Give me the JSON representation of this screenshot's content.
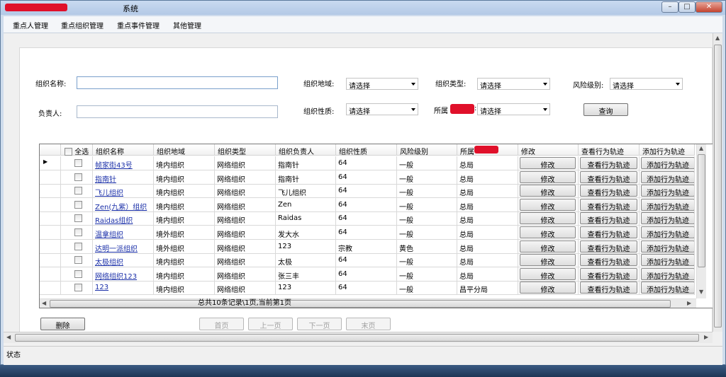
{
  "window": {
    "title": "系统",
    "title_prefix_redacted": "██████案系统",
    "controls": {
      "minimize": "–",
      "maximize": "□",
      "close": "✕"
    }
  },
  "menu": [
    "重点人管理",
    "重点组织管理",
    "重点事件管理",
    "其他管理"
  ],
  "filters": {
    "org_name_label": "组织名称:",
    "org_name_value": "",
    "owner_label": "负责人:",
    "owner_value": "",
    "region_label": "组织地域:",
    "region_value": "请选择",
    "type_label": "组织类型:",
    "type_value": "请选择",
    "risk_label": "风险级别:",
    "risk_value": "请选择",
    "nature_label": "组织性质:",
    "nature_value": "请选择",
    "belong_label": "所属",
    "belong_label_suffix": ":",
    "belong_value": "请选择",
    "query_button": "查询"
  },
  "grid": {
    "select_all": "全选",
    "columns": [
      "组织名称",
      "组织地域",
      "组织类型",
      "组织负责人",
      "组织性质",
      "风险级别",
      "所属",
      "修改",
      "查看行为轨迹",
      "添加行为轨迹"
    ],
    "row_buttons": {
      "edit": "修改",
      "view": "查看行为轨迹",
      "add": "添加行为轨迹"
    },
    "rows": [
      {
        "name": "帧家街43号",
        "region": "境内组织",
        "type": "网络组织",
        "owner": "指南针",
        "nature": "64",
        "risk": "一般",
        "belong": "总局"
      },
      {
        "name": "指南针",
        "region": "境内组织",
        "type": "网络组织",
        "owner": "指南针",
        "nature": "64",
        "risk": "一般",
        "belong": "总局"
      },
      {
        "name": "飞儿组织",
        "region": "境内组织",
        "type": "网络组织",
        "owner": "飞儿组织",
        "nature": "64",
        "risk": "一般",
        "belong": "总局"
      },
      {
        "name": "Zen(九紫）组织",
        "region": "境内组织",
        "type": "网络组织",
        "owner": "Zen",
        "nature": "64",
        "risk": "一般",
        "belong": "总局"
      },
      {
        "name": "Raidas组织",
        "region": "境内组织",
        "type": "网络组织",
        "owner": "Raidas",
        "nature": "64",
        "risk": "一般",
        "belong": "总局"
      },
      {
        "name": "温拿组织",
        "region": "境外组织",
        "type": "网络组织",
        "owner": "发大水",
        "nature": "64",
        "risk": "一般",
        "belong": "总局"
      },
      {
        "name": "达明一派组织",
        "region": "境外组织",
        "type": "网络组织",
        "owner": "123",
        "nature": "宗教",
        "risk": "黄色",
        "belong": "总局"
      },
      {
        "name": "太极组织",
        "region": "境内组织",
        "type": "网络组织",
        "owner": "太极",
        "nature": "64",
        "risk": "一般",
        "belong": "总局"
      },
      {
        "name": "网络组织123",
        "region": "境内组织",
        "type": "网络组织",
        "owner": "张三丰",
        "nature": "64",
        "risk": "一般",
        "belong": "总局"
      },
      {
        "name": "123",
        "region": "境内组织",
        "type": "网络组织",
        "owner": "123",
        "nature": "64",
        "risk": "一般",
        "belong": "昌平分局"
      }
    ]
  },
  "summary": "总共10条记录\\1页,当前第1页",
  "actions": {
    "delete": "删除"
  },
  "pager": {
    "first": "首页",
    "prev": "上一页",
    "next": "下一页",
    "last": "末页"
  },
  "status": "状态"
}
